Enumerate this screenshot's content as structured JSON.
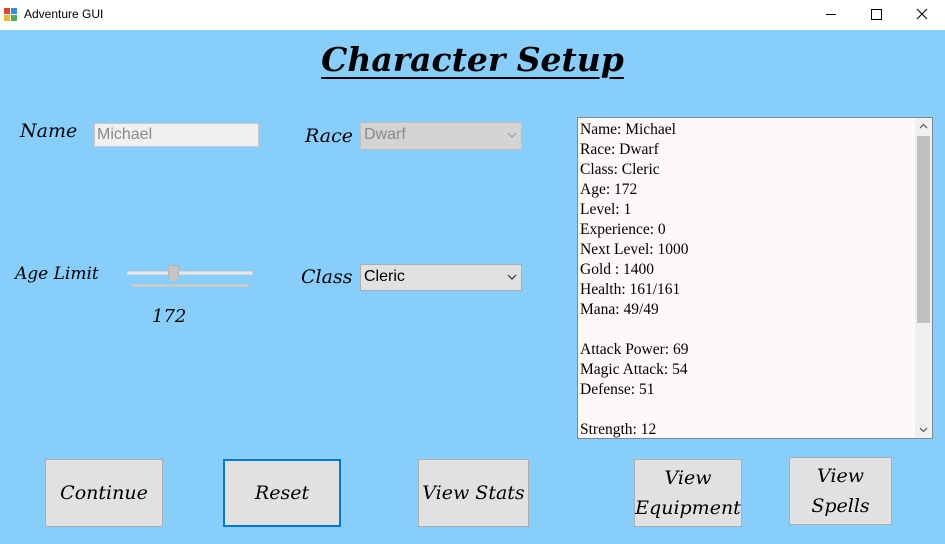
{
  "window": {
    "title": "Adventure GUI"
  },
  "heading": "Character Setup",
  "form": {
    "name_label": "Name",
    "name_value": "Michael",
    "race_label": "Race",
    "race_value": "Dwarf",
    "age_label": "Age Limit",
    "age_value": "172",
    "class_label": "Class",
    "class_value": "Cleric"
  },
  "stats": [
    "Name: Michael",
    "Race: Dwarf",
    "Class: Cleric",
    "Age: 172",
    "Level: 1",
    "Experience: 0",
    "Next Level: 1000",
    "Gold : 1400",
    "Health: 161/161",
    "Mana: 49/49",
    "",
    "Attack Power: 69",
    "Magic Attack: 54",
    "Defense: 51",
    "",
    "Strength: 12"
  ],
  "buttons": {
    "continue": "Continue",
    "reset": "Reset",
    "view_stats": "View Stats",
    "view_equipment_line1": "View",
    "view_equipment_line2": "Equipment",
    "view_spells": "View Spells"
  },
  "colors": {
    "background": "#87cefa",
    "focus_border": "#0078d7"
  }
}
